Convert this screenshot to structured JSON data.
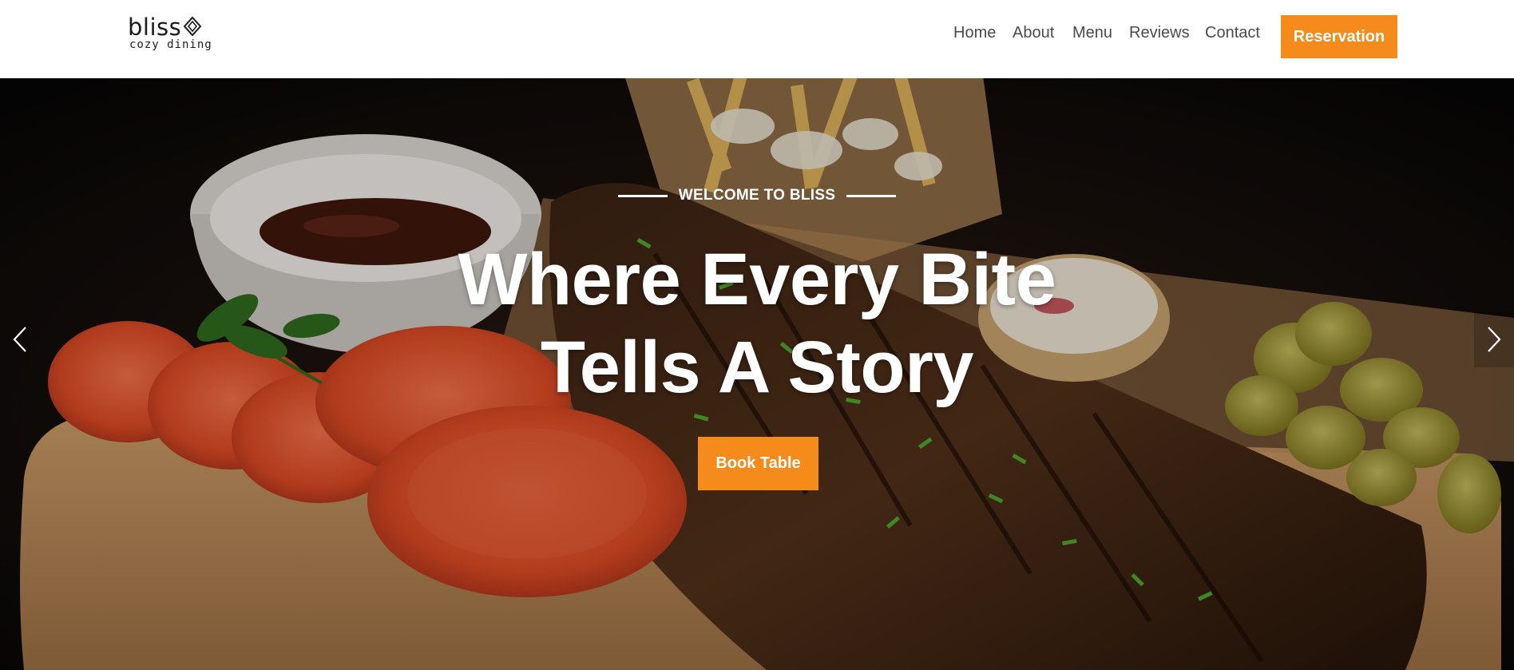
{
  "brand": {
    "name": "bliss",
    "tagline": "cozy dining"
  },
  "nav": {
    "links": [
      "Home",
      "About",
      "Menu",
      "Reviews",
      "Contact"
    ],
    "cta_label": "Reservation"
  },
  "hero": {
    "eyebrow": "WELCOME TO BLISS",
    "headline_line1": "Where Every Bite",
    "headline_line2": "Tells A Story",
    "button_label": "Book Table",
    "prev_icon": "chevron-left-icon",
    "next_icon": "chevron-right-icon"
  },
  "colors": {
    "accent": "#f48b1b",
    "header_bg": "#ffffff",
    "nav_text": "#4a4a4a",
    "hero_text": "#ffffff"
  }
}
